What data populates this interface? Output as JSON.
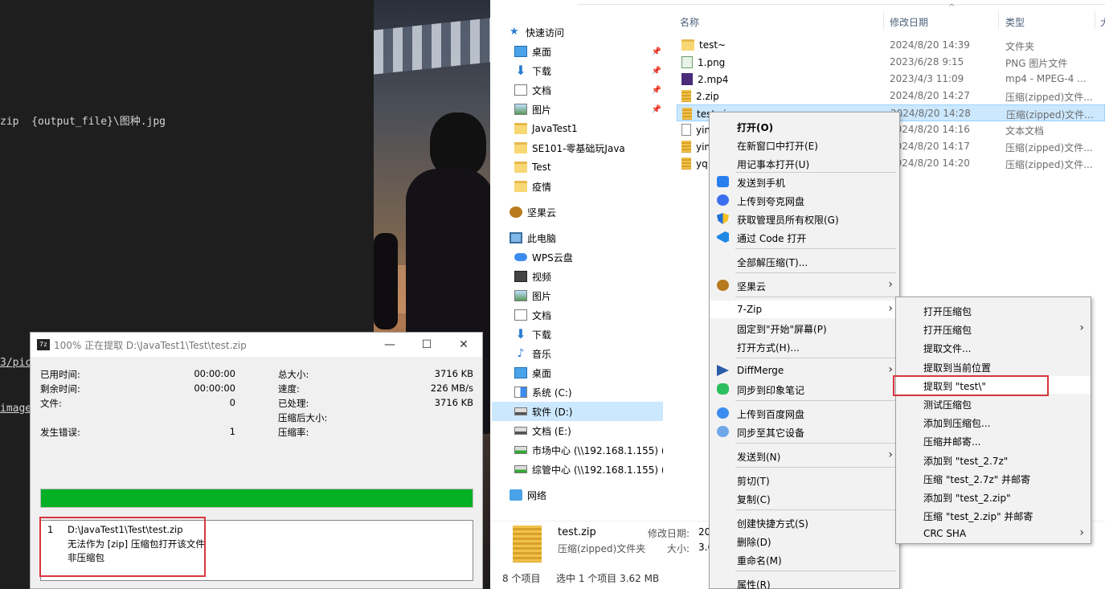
{
  "editor": {
    "line1": "zip  {output_file}\\图种.jpg",
    "line2": "3/pic",
    "line3": "images"
  },
  "zip_dialog": {
    "title": "100% 正在提取 D:\\JavaTest1\\Test\\test.zip",
    "icon_text": "7z",
    "min": "—",
    "max": "☐",
    "close": "✕",
    "stats_left": [
      {
        "label": "已用时间:",
        "value": "00:00:00"
      },
      {
        "label": "剩余时间:",
        "value": "00:00:00"
      },
      {
        "label": "文件:",
        "value": "0"
      },
      {
        "label": "发生错误:",
        "value": "1"
      }
    ],
    "stats_right": [
      {
        "label": "总大小:",
        "value": "3716 KB"
      },
      {
        "label": "速度:",
        "value": "226 MB/s"
      },
      {
        "label": "已处理:",
        "value": "3716 KB"
      },
      {
        "label": "压缩后大小:",
        "value": ""
      },
      {
        "label": "压缩率:",
        "value": ""
      }
    ],
    "progress": 1.0,
    "progress_color": "#06b025",
    "log": {
      "index": "1",
      "path": "D:\\JavaTest1\\Test\\test.zip",
      "msg1": "无法作为 [zip] 压缩包打开该文件",
      "msg2": "非压缩包"
    }
  },
  "explorer": {
    "nav": {
      "quick_access": "快速访问",
      "quick_items": [
        {
          "label": "桌面",
          "icon": "desktop-icon",
          "pinned": true
        },
        {
          "label": "下载",
          "icon": "download-icon",
          "pinned": true
        },
        {
          "label": "文档",
          "icon": "document-icon",
          "pinned": true
        },
        {
          "label": "图片",
          "icon": "picture-icon",
          "pinned": true
        },
        {
          "label": "JavaTest1",
          "icon": "folder-icon",
          "pinned": false
        },
        {
          "label": "SE101-零基础玩Java",
          "icon": "folder-icon",
          "pinned": false
        },
        {
          "label": "Test",
          "icon": "folder-icon",
          "pinned": false
        },
        {
          "label": "疫情",
          "icon": "folder-icon",
          "pinned": false
        }
      ],
      "jianguoyun": "坚果云",
      "this_pc": "此电脑",
      "pc_items": [
        {
          "label": "WPS云盘",
          "icon": "cloud-icon"
        },
        {
          "label": "视频",
          "icon": "video-icon"
        },
        {
          "label": "图片",
          "icon": "picture-icon"
        },
        {
          "label": "文档",
          "icon": "document-icon"
        },
        {
          "label": "下载",
          "icon": "download-icon"
        },
        {
          "label": "音乐",
          "icon": "music-icon"
        },
        {
          "label": "桌面",
          "icon": "desktop-icon"
        },
        {
          "label": "系统 (C:)",
          "icon": "windows-drive-icon"
        },
        {
          "label": "软件 (D:)",
          "icon": "drive-icon",
          "selected": true
        },
        {
          "label": "文档 (E:)",
          "icon": "drive-icon"
        },
        {
          "label": "市场中心 (\\\\192.168.1.155) (\\",
          "icon": "network-drive-icon"
        },
        {
          "label": "综管中心 (\\\\192.168.1.155) (Z",
          "icon": "network-drive-icon"
        }
      ],
      "network": "网络"
    },
    "columns": {
      "name": "名称",
      "date": "修改日期",
      "type": "类型",
      "size": "大"
    },
    "files": [
      {
        "name": "test~",
        "date": "2024/8/20 14:39",
        "type": "文件夹",
        "icon": "folder-icon"
      },
      {
        "name": "1.png",
        "date": "2023/6/28 9:15",
        "type": "PNG 图片文件",
        "icon": "png-icon"
      },
      {
        "name": "2.mp4",
        "date": "2023/4/3 11:09",
        "type": "mp4 - MPEG-4 ...",
        "icon": "mp4-icon"
      },
      {
        "name": "2.zip",
        "date": "2024/8/20 14:27",
        "type": "压缩(zipped)文件...",
        "icon": "zip-icon"
      },
      {
        "name": "test.zip",
        "date": "2024/8/20 14:28",
        "type": "压缩(zipped)文件...",
        "icon": "zip-icon",
        "selected": true
      },
      {
        "name": "yin",
        "date": "2024/8/20 14:16",
        "type": "文本文档",
        "icon": "txt-icon"
      },
      {
        "name": "yin",
        "date": "2024/8/20 14:17",
        "type": "压缩(zipped)文件...",
        "icon": "zip-icon"
      },
      {
        "name": "yq",
        "date": "2024/8/20 14:20",
        "type": "压缩(zipped)文件...",
        "icon": "zip-icon"
      }
    ],
    "details": {
      "name": "test.zip",
      "type": "压缩(zipped)文件夹",
      "modified_label": "修改日期:",
      "modified_value": "20",
      "size_label": "大小:",
      "size_value": "3.6"
    },
    "status": {
      "count": "8 个项目",
      "selection": "选中 1 个项目  3.62 MB"
    }
  },
  "context_menu": {
    "items": [
      {
        "label": "打开(O)",
        "bold": true
      },
      {
        "label": "在新窗口中打开(E)"
      },
      {
        "label": "用记事本打开(U)"
      },
      {
        "label": "发送到手机",
        "icon": "phone-icon"
      },
      {
        "label": "上传到夸克网盘",
        "icon": "quark-icon"
      },
      {
        "label": "获取管理员所有权限(G)",
        "icon": "shield-icon"
      },
      {
        "label": "通过 Code 打开",
        "icon": "vscode-icon"
      },
      {
        "label": "全部解压缩(T)..."
      },
      {
        "label": "坚果云",
        "icon": "nut-icon",
        "submenu": true
      },
      {
        "label": "7-Zip",
        "submenu": true,
        "highlighted": true
      },
      {
        "label": "固定到\"开始\"屏幕(P)"
      },
      {
        "label": "打开方式(H)..."
      },
      {
        "label": "DiffMerge",
        "icon": "diffmerge-icon",
        "submenu": true
      },
      {
        "label": "同步到印象笔记",
        "icon": "evernote-icon"
      },
      {
        "label": "上传到百度网盘",
        "icon": "baidu-icon"
      },
      {
        "label": "同步至其它设备",
        "icon": "share-icon"
      },
      {
        "label": "发送到(N)",
        "submenu": true
      },
      {
        "label": "剪切(T)"
      },
      {
        "label": "复制(C)"
      },
      {
        "label": "创建快捷方式(S)"
      },
      {
        "label": "删除(D)"
      },
      {
        "label": "重命名(M)"
      },
      {
        "label": "属性(R)"
      }
    ]
  },
  "zip_submenu": {
    "items": [
      {
        "label": "打开压缩包"
      },
      {
        "label": "打开压缩包",
        "submenu": true
      },
      {
        "label": "提取文件..."
      },
      {
        "label": "提取到当前位置"
      },
      {
        "label": "提取到 \"test\\\"",
        "highlighted": true
      },
      {
        "label": "测试压缩包"
      },
      {
        "label": "添加到压缩包..."
      },
      {
        "label": "压缩并邮寄..."
      },
      {
        "label": "添加到 \"test_2.7z\""
      },
      {
        "label": "压缩 \"test_2.7z\" 并邮寄"
      },
      {
        "label": "添加到 \"test_2.zip\""
      },
      {
        "label": "压缩 \"test_2.zip\" 并邮寄"
      },
      {
        "label": "CRC SHA",
        "submenu": true
      }
    ]
  },
  "colors": {
    "highlight_box": "#d9363e",
    "selection": "#cce8ff",
    "progress": "#06b025"
  }
}
